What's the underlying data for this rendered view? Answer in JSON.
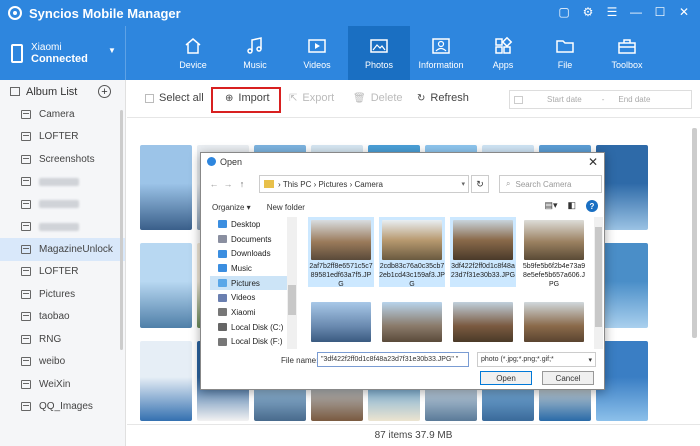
{
  "app": {
    "title": "Syncios Mobile Manager",
    "window_buttons": [
      "▢",
      "⚙",
      "☰",
      "—",
      "☐",
      "✕"
    ]
  },
  "device": {
    "name": "Xiaomi",
    "status": "Connected"
  },
  "nav": [
    {
      "label": "Device",
      "icon": "home-icon"
    },
    {
      "label": "Music",
      "icon": "music-icon"
    },
    {
      "label": "Videos",
      "icon": "video-icon"
    },
    {
      "label": "Photos",
      "icon": "photo-icon",
      "active": true
    },
    {
      "label": "Information",
      "icon": "contact-icon"
    },
    {
      "label": "Apps",
      "icon": "apps-icon"
    },
    {
      "label": "File",
      "icon": "folder-icon"
    },
    {
      "label": "Toolbox",
      "icon": "toolbox-icon"
    }
  ],
  "sidebar": {
    "header": "Album List",
    "albums": [
      "Camera",
      "LOFTER",
      "Screenshots",
      "",
      "",
      "",
      "MagazineUnlock",
      "LOFTER",
      "Pictures",
      "taobao",
      "RNG",
      "weibo",
      "WeiXin",
      "QQ_Images"
    ],
    "active_index": 6
  },
  "toolbar": {
    "select_all": "Select all",
    "import": "Import",
    "export": "Export",
    "delete": "Delete",
    "refresh": "Refresh",
    "start_date": "Start date",
    "end_date": "End date"
  },
  "status": {
    "text": "87 items 37.9 MB"
  },
  "dialog": {
    "title": "Open",
    "path": [
      "This PC",
      "Pictures",
      "Camera"
    ],
    "search_placeholder": "Search Camera",
    "organize": "Organize ▾",
    "new_folder": "New folder",
    "nav_items": [
      "Desktop",
      "Documents",
      "Downloads",
      "Music",
      "Pictures",
      "Videos",
      "Xiaomi",
      "Local Disk (C:)",
      "Local Disk (F:)"
    ],
    "nav_selected": 4,
    "files": [
      {
        "name": "2af7b2ff8e6571c5c789581edf63a7f5.JPG",
        "selected": true
      },
      {
        "name": "2cdb83c76a0c35cb72eb1cd43c159af3.JPG",
        "selected": true
      },
      {
        "name": "3df422f2ff0d1c8f48a23d7f31e30b33.JPG",
        "selected": true
      },
      {
        "name": "5b9fe5b6f2b4e73a98e5efe5b657a606.JPG",
        "selected": false
      },
      {
        "name": "",
        "selected": false
      },
      {
        "name": "",
        "selected": false
      },
      {
        "name": "",
        "selected": false
      },
      {
        "name": "",
        "selected": false
      }
    ],
    "file_name_label": "File name:",
    "file_name_value": "\"3df422f2ff0d1c8f48a23d7f31e30b33.JPG\" \"",
    "file_type": "photo (*.jpg;*.png;*.gif;*",
    "open": "Open",
    "cancel": "Cancel"
  }
}
